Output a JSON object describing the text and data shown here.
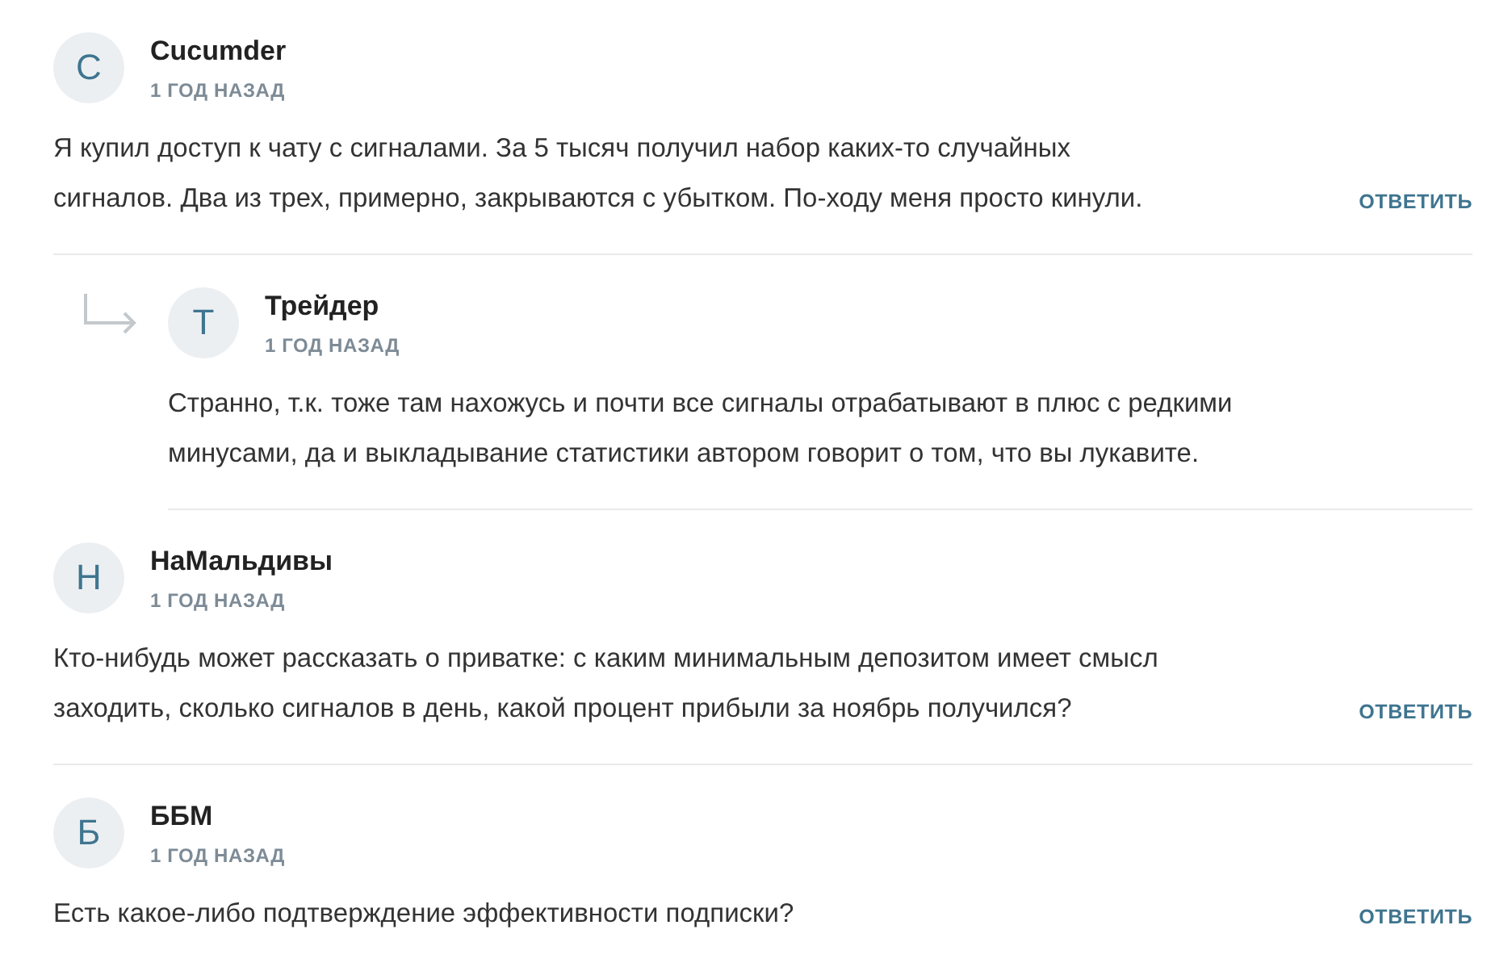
{
  "comments": [
    {
      "avatar": "C",
      "author": "Cucumder",
      "date": "1 ГОД НАЗАД",
      "text": "Я купил доступ к чату с сигналами. За 5 тысяч получил набор каких-то случайных\nсигналов. Два из трех, примерно, закрываются с убытком. По-ходу меня просто кинули.",
      "reply_label": "ОТВЕТИТЬ",
      "children": [
        {
          "avatar": "Т",
          "author": "Трейдер",
          "date": "1 ГОД НАЗАД",
          "text": "Странно, т.к. тоже там нахожусь и почти все сигналы отрабатывают в плюс с редкими\nминусами, да и выкладывание статистики автором говорит о том, что вы лукавите."
        }
      ]
    },
    {
      "avatar": "Н",
      "author": "НаМальдивы",
      "date": "1 ГОД НАЗАД",
      "text": "Кто-нибудь может рассказать о приватке: с каким минимальным депозитом имеет смысл\nзаходить, сколько сигналов в день, какой процент прибыли за ноябрь получился?",
      "reply_label": "ОТВЕТИТЬ"
    },
    {
      "avatar": "Б",
      "author": "ББМ",
      "date": "1 ГОД НАЗАД",
      "text": "Есть какое-либо подтверждение эффективности подписки?",
      "reply_label": "ОТВЕТИТЬ"
    }
  ]
}
